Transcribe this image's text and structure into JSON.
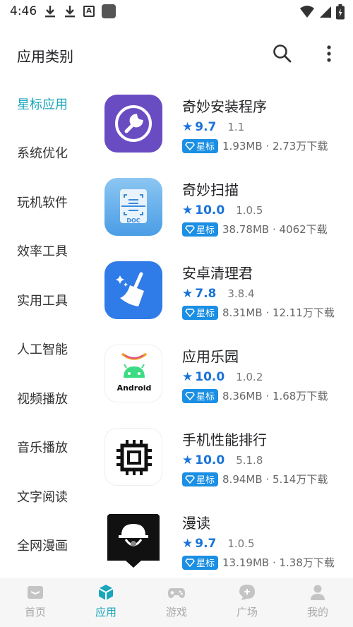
{
  "status_bar": {
    "time": "4:46",
    "icons": [
      "download-icon",
      "download-icon",
      "font-a-icon",
      "app-square-icon",
      "wifi-icon",
      "signal-icon",
      "battery-charging-icon"
    ]
  },
  "header": {
    "title": "应用类别",
    "search_icon": "search-icon",
    "more_icon": "more-vertical-icon"
  },
  "sidebar": {
    "items": [
      {
        "label": "星标应用",
        "active": true
      },
      {
        "label": "系统优化"
      },
      {
        "label": "玩机软件"
      },
      {
        "label": "效率工具"
      },
      {
        "label": "实用工具"
      },
      {
        "label": "人工智能"
      },
      {
        "label": "视频播放"
      },
      {
        "label": "音乐播放"
      },
      {
        "label": "文字阅读"
      },
      {
        "label": "全网漫画"
      }
    ]
  },
  "apps": [
    {
      "name": "奇妙安装程序",
      "rating": "9.7",
      "version": "1.1",
      "badge": "星标",
      "info": "1.93MB · 2.73万下载",
      "icon": "wrench-icon"
    },
    {
      "name": "奇妙扫描",
      "rating": "10.0",
      "version": "1.0.5",
      "badge": "星标",
      "info": "38.78MB · 4062下载",
      "icon": "doc-scan-icon",
      "icon_text": "DOC"
    },
    {
      "name": "安卓清理君",
      "rating": "7.8",
      "version": "3.8.4",
      "badge": "星标",
      "info": "8.31MB · 12.11万下载",
      "icon": "broom-icon"
    },
    {
      "name": "应用乐园",
      "rating": "10.0",
      "version": "1.0.2",
      "badge": "星标",
      "info": "8.36MB · 1.68万下载",
      "icon": "android-icon",
      "icon_text": "Android"
    },
    {
      "name": "手机性能排行",
      "rating": "10.0",
      "version": "5.1.8",
      "badge": "星标",
      "info": "8.94MB · 5.14万下载",
      "icon": "chip-icon"
    },
    {
      "name": "漫读",
      "rating": "9.7",
      "version": "1.0.5",
      "badge": "星标",
      "info": "13.19MB · 1.38万下载",
      "icon": "comic-reader-icon"
    }
  ],
  "bottom_nav": {
    "items": [
      {
        "label": "首页",
        "icon": "home-mail-icon"
      },
      {
        "label": "应用",
        "icon": "cube-icon",
        "active": true
      },
      {
        "label": "游戏",
        "icon": "gamepad-icon"
      },
      {
        "label": "广场",
        "icon": "chat-bubble-icon"
      },
      {
        "label": "我的",
        "icon": "person-icon"
      }
    ]
  },
  "colors": {
    "accent": "#1aa6bb",
    "rating_blue": "#1a73d9",
    "badge_blue": "#1a8fe3",
    "sidebar_active_bg": "#e3f5f8"
  }
}
